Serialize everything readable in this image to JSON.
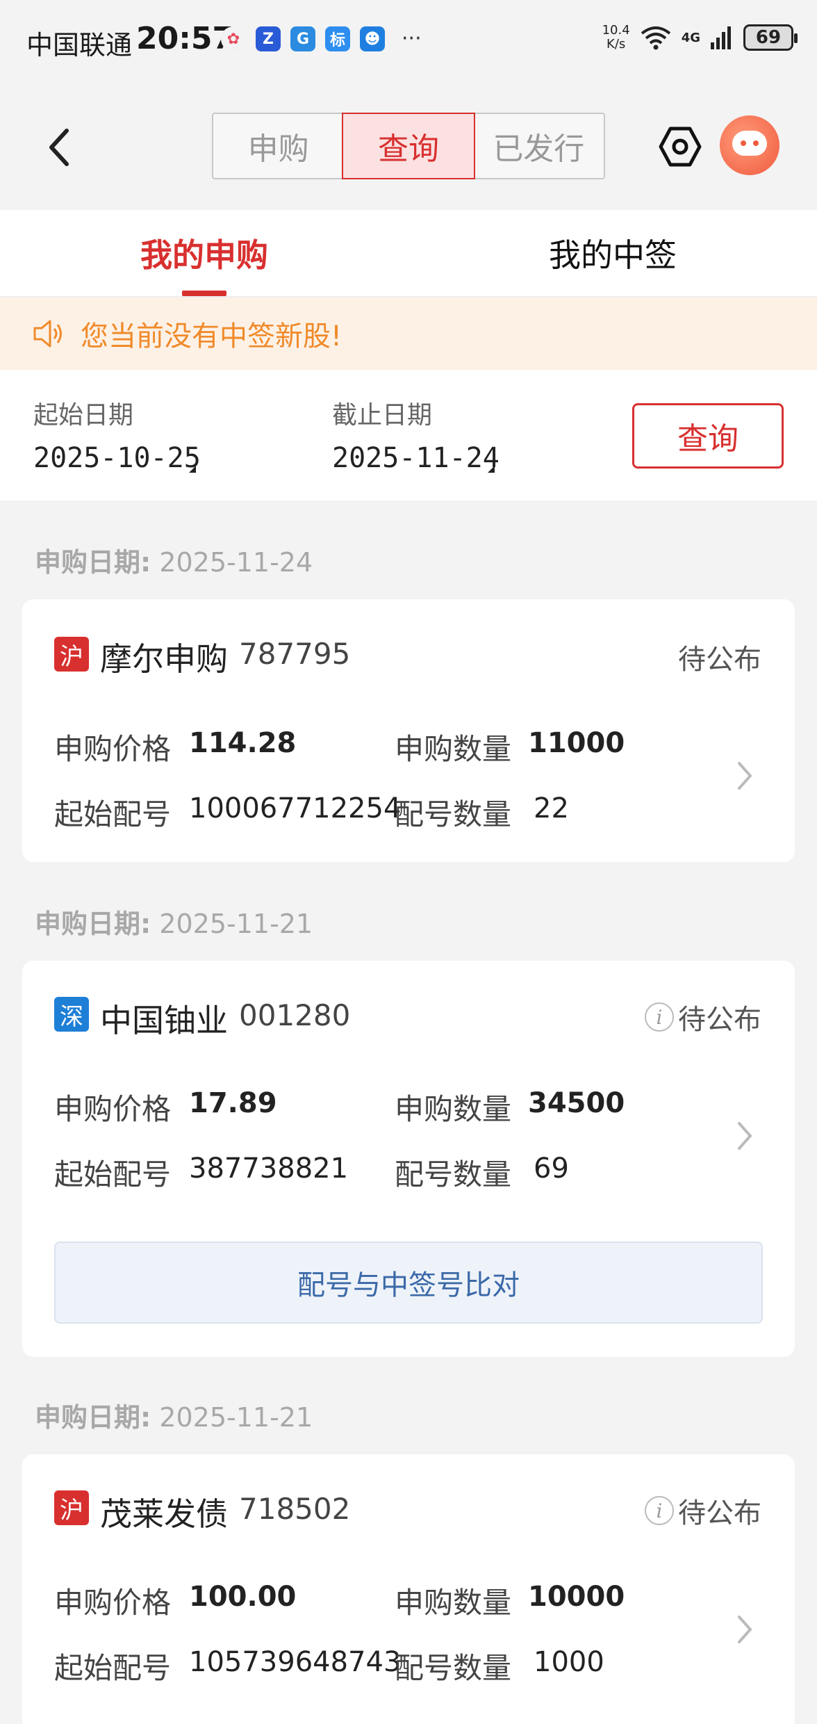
{
  "status_bar": {
    "carrier": "中国联通",
    "time": "20:57",
    "apps": [
      {
        "icon": "pinwheel-app-icon",
        "color": "#f2f2f2",
        "glyph": "✿"
      },
      {
        "icon": "z-app-icon",
        "color": "#2a5bd7",
        "glyph": "Z"
      },
      {
        "icon": "g-app-icon",
        "color": "#2a8be0",
        "glyph": "G"
      },
      {
        "icon": "biao-app-icon",
        "color": "#2e8ef0",
        "glyph": "标"
      },
      {
        "icon": "robot-app-icon",
        "color": "#1f7fe0",
        "glyph": "☻"
      }
    ],
    "more": "···",
    "speed_value": "10.4",
    "speed_unit": "K/s",
    "network": "4G",
    "battery": "69"
  },
  "header": {
    "tabs": [
      {
        "label": "申购",
        "active": false
      },
      {
        "label": "查询",
        "active": true
      },
      {
        "label": "已发行",
        "active": false
      }
    ]
  },
  "sub_tabs": [
    {
      "label": "我的申购",
      "active": true
    },
    {
      "label": "我的中签",
      "active": false
    }
  ],
  "notice": {
    "text": "您当前没有中签新股!"
  },
  "filter": {
    "start_label": "起始日期",
    "start_value": "2025-10-25",
    "end_label": "截止日期",
    "end_value": "2025-11-24",
    "query_button": "查询"
  },
  "groups": [
    {
      "date_label": "申购日期:",
      "date": "2025-11-24",
      "market": "沪",
      "name": "摩尔申购",
      "code": "787795",
      "status": "待公布",
      "price_label": "申购价格",
      "price": "114.28",
      "qty_label": "申购数量",
      "qty": "11000",
      "start_no_label": "起始配号",
      "start_no": "100067712254",
      "count_label": "配号数量",
      "count": "22"
    },
    {
      "date_label": "申购日期:",
      "date": "2025-11-21",
      "market": "深",
      "name": "中国铀业",
      "code": "001280",
      "status": "待公布",
      "price_label": "申购价格",
      "price": "17.89",
      "qty_label": "申购数量",
      "qty": "34500",
      "start_no_label": "起始配号",
      "start_no": "387738821",
      "count_label": "配号数量",
      "count": "69",
      "compare_button": "配号与中签号比对"
    },
    {
      "date_label": "申购日期:",
      "date": "2025-11-21",
      "market": "沪",
      "name": "茂莱发债",
      "code": "718502",
      "status": "待公布",
      "price_label": "申购价格",
      "price": "100.00",
      "qty_label": "申购数量",
      "qty": "10000",
      "start_no_label": "起始配号",
      "start_no": "105739648743",
      "count_label": "配号数量",
      "count": "1000"
    }
  ],
  "colors": {
    "accent": "#d8302f",
    "sh_badge": "#d8302f",
    "sz_badge": "#1e7fd6",
    "notice_text": "#f08a2a",
    "compare_text": "#3b69a8"
  }
}
